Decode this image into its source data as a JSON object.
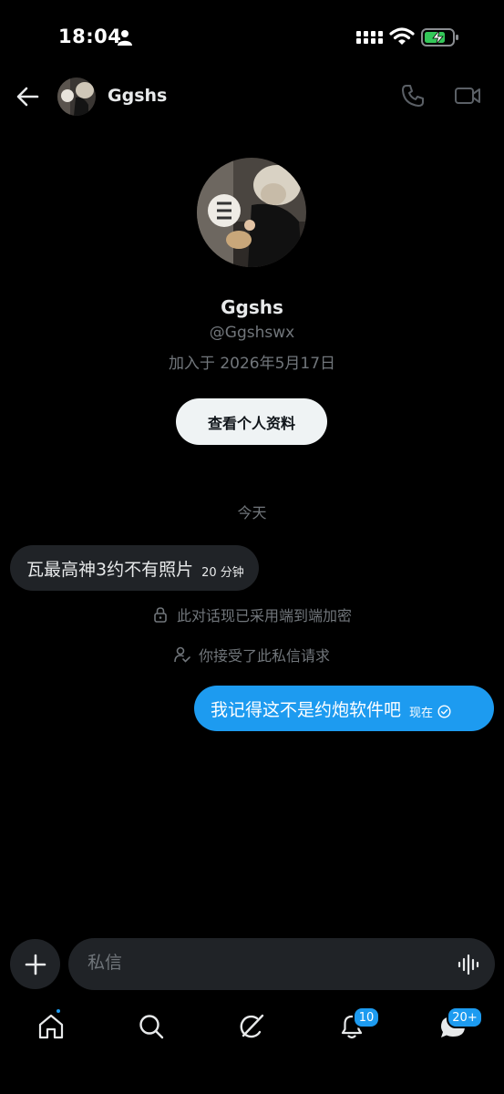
{
  "status_bar": {
    "time": "18:04"
  },
  "header": {
    "name": "Ggshs"
  },
  "profile": {
    "name": "Ggshs",
    "handle": "@Ggshswx",
    "joined": "加入于 2026年5月17日",
    "view_profile_label": "查看个人资料"
  },
  "conversation": {
    "day_label": "今天",
    "messages": [
      {
        "direction": "in",
        "text": "瓦最高神3约不有照片",
        "time": "20 分钟"
      },
      {
        "direction": "out",
        "text": "我记得这不是约炮软件吧",
        "time": "现在"
      }
    ],
    "system_notes": {
      "encrypted": "此对话现已采用端到端加密",
      "accepted": "你接受了此私信请求"
    }
  },
  "composer": {
    "placeholder": "私信"
  },
  "tabbar": {
    "notifications_badge": "10",
    "messages_badge": "20+"
  },
  "colors": {
    "accent": "#1d9bf0",
    "background": "#000000",
    "bubble_in": "#202327"
  }
}
